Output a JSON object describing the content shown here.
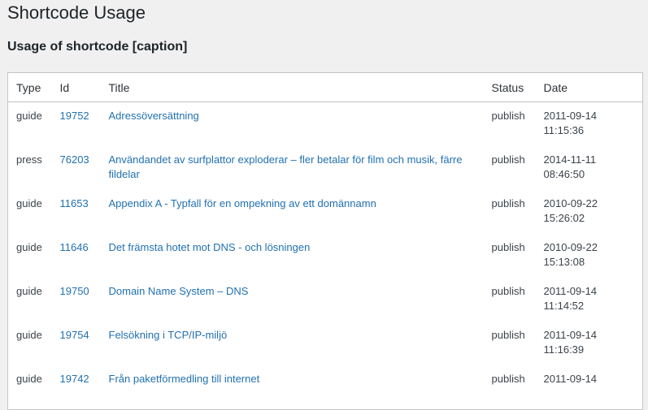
{
  "page_title": "Shortcode Usage",
  "section_heading": "Usage of shortcode [caption]",
  "columns": [
    "Type",
    "Id",
    "Title",
    "Status",
    "Date"
  ],
  "rows": [
    {
      "type": "guide",
      "id": "19752",
      "title": "Adressöversättning",
      "status": "publish",
      "date": "2011-09-14",
      "time": "11:15:36"
    },
    {
      "type": "press",
      "id": "76203",
      "title": "Användandet av surfplattor exploderar – fler betalar för film och musik, färre fildelar",
      "status": "publish",
      "date": "2014-11-11",
      "time": "08:46:50"
    },
    {
      "type": "guide",
      "id": "11653",
      "title": "Appendix A - Typfall för en ompekning av ett domännamn",
      "status": "publish",
      "date": "2010-09-22",
      "time": "15:26:02"
    },
    {
      "type": "guide",
      "id": "11646",
      "title": "Det främsta hotet mot DNS - och lösningen",
      "status": "publish",
      "date": "2010-09-22",
      "time": "15:13:08"
    },
    {
      "type": "guide",
      "id": "19750",
      "title": "Domain Name System – DNS",
      "status": "publish",
      "date": "2011-09-14",
      "time": "11:14:52"
    },
    {
      "type": "guide",
      "id": "19754",
      "title": "Felsökning i TCP/IP-miljö",
      "status": "publish",
      "date": "2011-09-14",
      "time": "11:16:39"
    },
    {
      "type": "guide",
      "id": "19742",
      "title": "Från paketförmedling till internet",
      "status": "publish",
      "date": "2011-09-14",
      "time": ""
    }
  ]
}
